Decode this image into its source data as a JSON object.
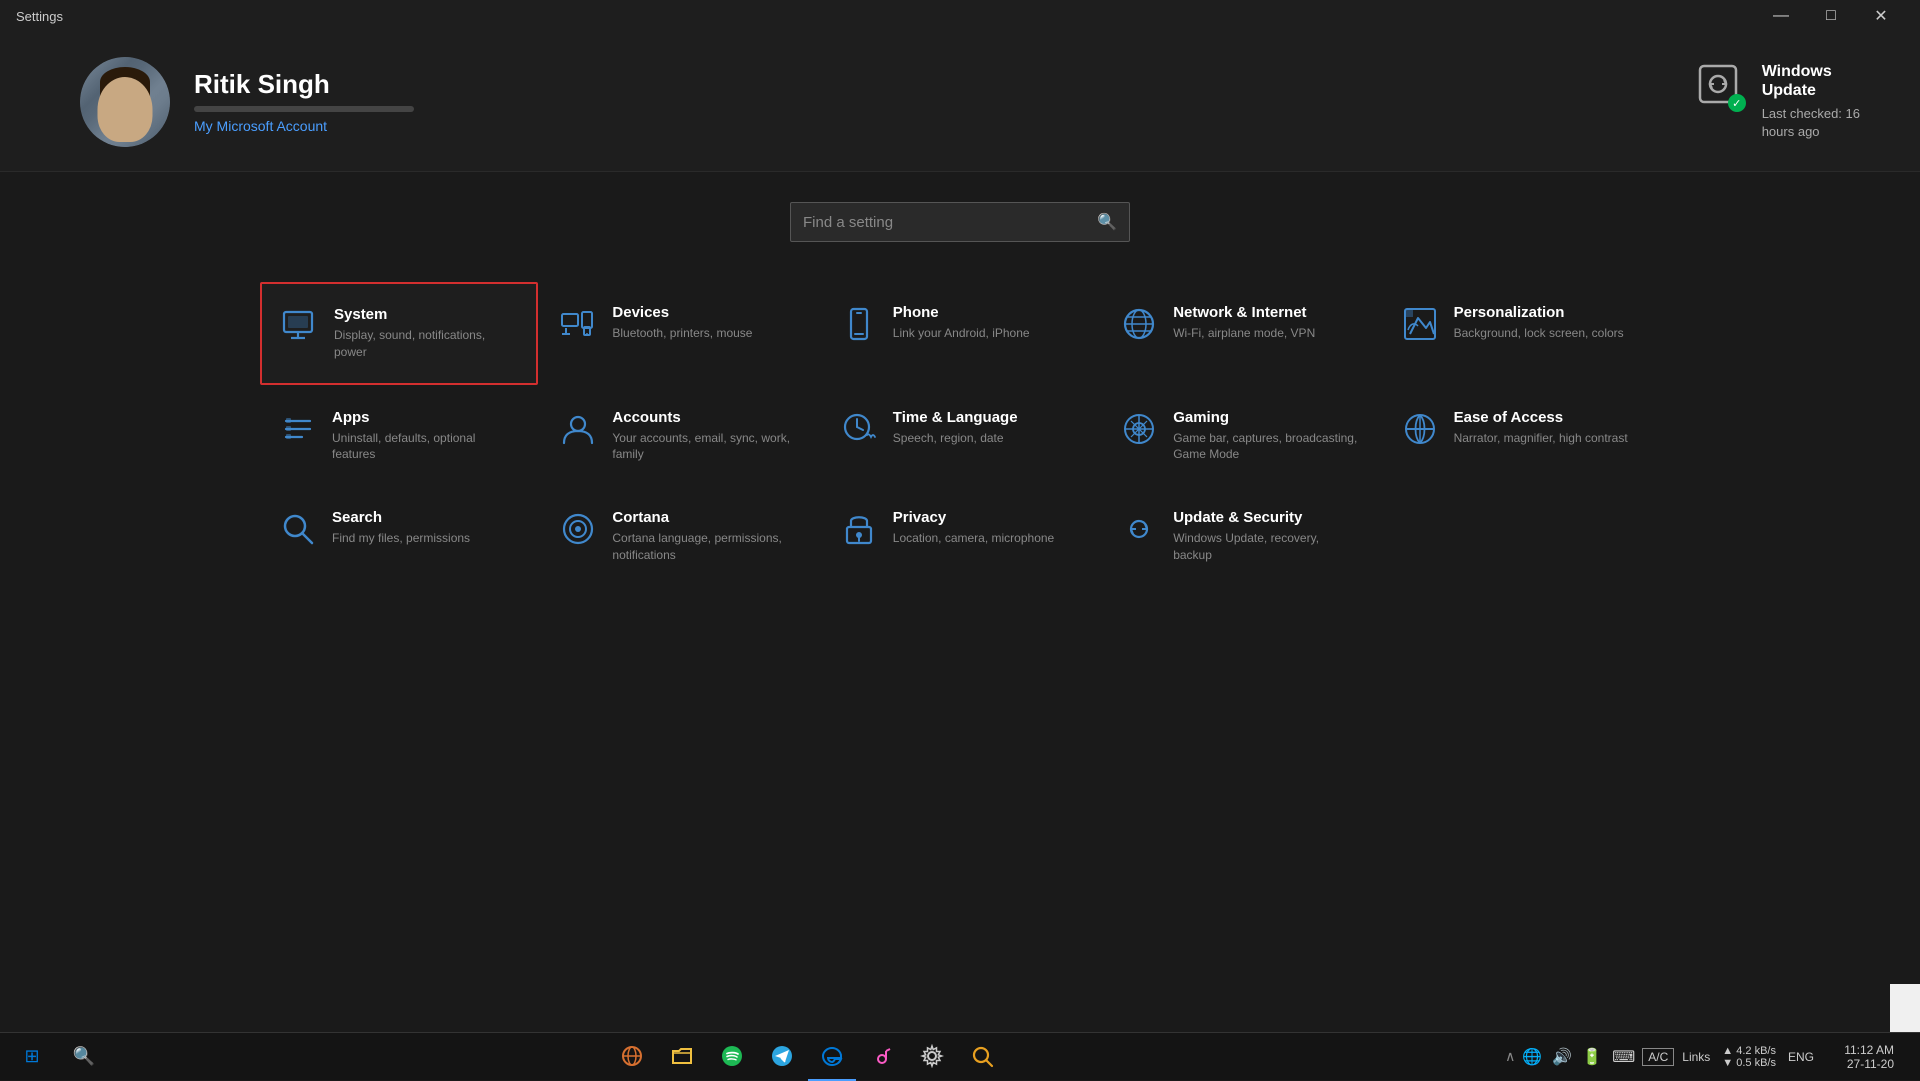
{
  "titlebar": {
    "title": "Settings",
    "minimize": "—",
    "maximize": "□",
    "close": "✕"
  },
  "header": {
    "user": {
      "name": "Ritik Singh",
      "account_link": "My Microsoft Account"
    },
    "windows_update": {
      "title": "Windows\nUpdate",
      "subtitle": "Last checked: 16\nhours ago"
    }
  },
  "search": {
    "placeholder": "Find a setting"
  },
  "settings": [
    {
      "id": "system",
      "title": "System",
      "desc": "Display, sound,\nnotifications, power",
      "selected": true
    },
    {
      "id": "devices",
      "title": "Devices",
      "desc": "Bluetooth, printers, mouse",
      "selected": false
    },
    {
      "id": "phone",
      "title": "Phone",
      "desc": "Link your Android, iPhone",
      "selected": false
    },
    {
      "id": "network",
      "title": "Network & Internet",
      "desc": "Wi-Fi, airplane mode, VPN",
      "selected": false
    },
    {
      "id": "personalization",
      "title": "Personalization",
      "desc": "Background, lock screen, colors",
      "selected": false
    },
    {
      "id": "apps",
      "title": "Apps",
      "desc": "Uninstall, defaults,\noptional features",
      "selected": false
    },
    {
      "id": "accounts",
      "title": "Accounts",
      "desc": "Your accounts, email, sync,\nwork, family",
      "selected": false
    },
    {
      "id": "time",
      "title": "Time & Language",
      "desc": "Speech, region, date",
      "selected": false
    },
    {
      "id": "gaming",
      "title": "Gaming",
      "desc": "Game bar, captures,\nbroadcasting, Game Mode",
      "selected": false
    },
    {
      "id": "ease",
      "title": "Ease of Access",
      "desc": "Narrator, magnifier, high\ncontrast",
      "selected": false
    },
    {
      "id": "search",
      "title": "Search",
      "desc": "Find my files, permissions",
      "selected": false
    },
    {
      "id": "cortana",
      "title": "Cortana",
      "desc": "Cortana language,\npermissions, notifications",
      "selected": false
    },
    {
      "id": "privacy",
      "title": "Privacy",
      "desc": "Location, camera,\nmicrophone",
      "selected": false
    },
    {
      "id": "update",
      "title": "Update & Security",
      "desc": "Windows Update,\nrecovery, backup",
      "selected": false
    }
  ],
  "taskbar": {
    "time": "11:12 AM",
    "date": "27-11-20",
    "network_down": "Down",
    "network_up": "Up",
    "network_speed": "4.2 kB/s\n0.5 kB/s",
    "ac_label": "A/C",
    "links_label": "Links",
    "language": "ENG"
  },
  "colors": {
    "accent_blue": "#4a9eff",
    "icon_blue": "#4088cc",
    "selected_border": "#d32f2f",
    "background": "#1a1a1a",
    "header_bg": "#1e1e1e"
  }
}
